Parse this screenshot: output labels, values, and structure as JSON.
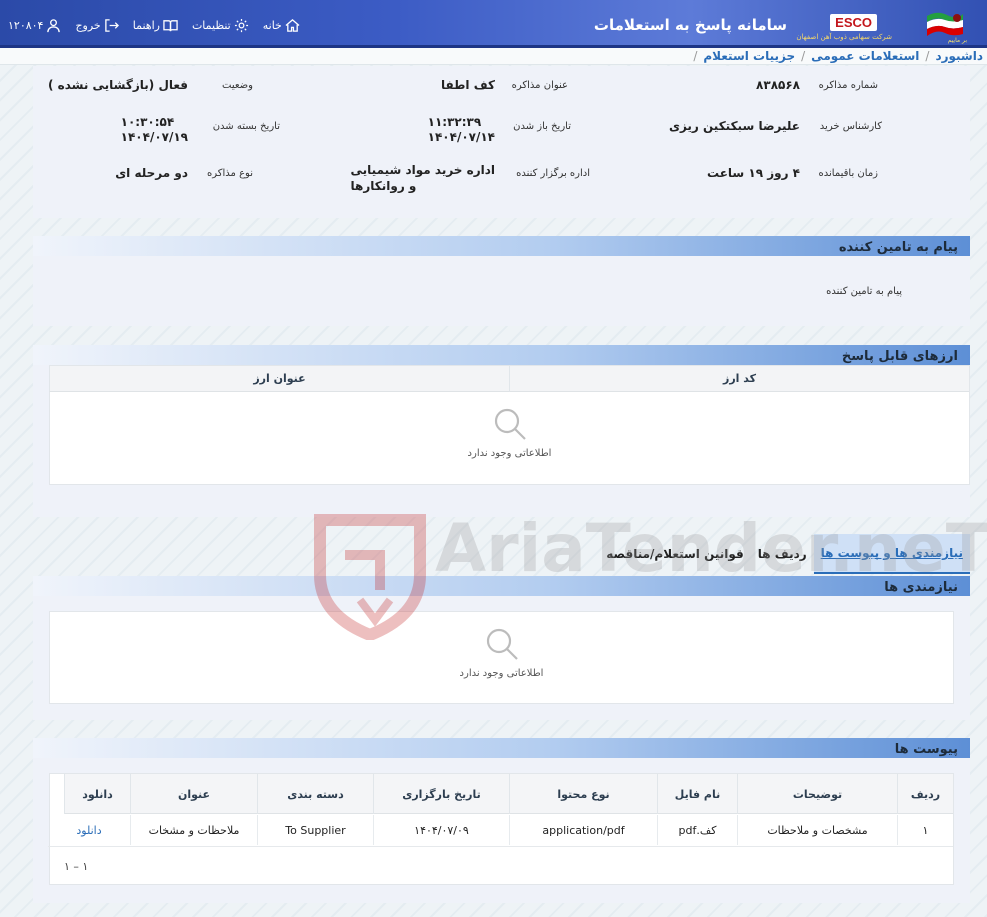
{
  "header": {
    "title": "سامانه پاسخ به استعلامات",
    "brand": "ESCO",
    "brand_sub": "شرکت سهامی ذوب آهن اصفهان",
    "flag_caption": "بر ماییم",
    "nav": {
      "user_id": "۱۲۰۸۰۴",
      "logout": "خروج",
      "guide": "راهنما",
      "settings": "تنظیمات",
      "home": "خانه"
    }
  },
  "breadcrumb": {
    "items": [
      "داشبورد",
      "استعلامات عمومی",
      "جزییات استعلام"
    ]
  },
  "info": {
    "labels": {
      "number": "شماره مذاکره",
      "subject": "عنوان مذاکره",
      "status": "وضعیت",
      "expert": "کارشناس خرید",
      "open_date": "تاریخ باز شدن",
      "close_date": "تاریخ بسته شدن",
      "remaining": "زمان باقیمانده",
      "organizer": "اداره برگزار کننده",
      "type": "نوع مذاکره"
    },
    "values": {
      "number": "۸۳۸۵۶۸",
      "subject": "کف اطفا",
      "status": "فعال (بازگشایی نشده )",
      "expert": "علیرضا سبکتکین ریزی",
      "open_time": "۱۱:۳۲:۳۹",
      "open_day": "۱۴۰۴/۰۷/۱۴",
      "close_time": "۱۰:۳۰:۵۴",
      "close_day": "۱۴۰۴/۰۷/۱۹",
      "remaining": "۴ روز ۱۹ ساعت",
      "organizer_l1": "اداره خرید مواد شیمیایی",
      "organizer_l2": "و روانکارها",
      "type": "دو مرحله ای"
    }
  },
  "supplier_message": {
    "title": "پیام به تامین کننده",
    "text": "پیام به تامین کننده"
  },
  "currencies": {
    "title": "ارزهای قابل پاسخ",
    "columns": [
      "کد ارز",
      "عنوان ارز"
    ],
    "empty": "اطلاعاتی وجود ندارد"
  },
  "tabs": [
    "نیازمندی ها و پیوست ها",
    "ردیف ها",
    "قوانین استعلام/مناقصه"
  ],
  "requirements": {
    "title": "نیازمندی ها",
    "empty": "اطلاعاتی وجود ندارد"
  },
  "attachments": {
    "title": "پیوست ها",
    "columns": [
      "ردیف",
      "توضیحات",
      "نام فایل",
      "نوع محتوا",
      "تاریخ بارگزاری",
      "دسته بندی",
      "عنوان",
      "دانلود"
    ],
    "rows": [
      [
        "۱",
        "مشخصات و ملاحظات",
        "کف.pdf",
        "application/pdf",
        "۱۴۰۴/۰۷/۰۹",
        "To Supplier",
        "ملاحظات و مشخات",
        "دانلود"
      ]
    ],
    "pager": "۱ – ۱"
  },
  "watermark": "AriaTender.neT",
  "colors": {
    "header": "#3c5cc5",
    "link": "#2a6db8",
    "panel": "#eff2f9",
    "watermark": "#c21d1d"
  }
}
